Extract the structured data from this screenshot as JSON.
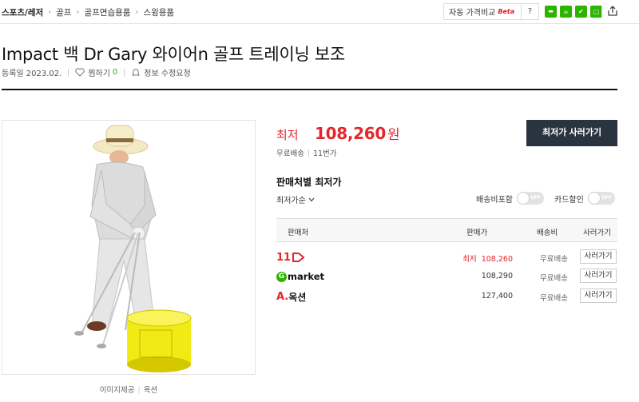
{
  "breadcrumb": {
    "items": [
      "스포츠/레저",
      "골프",
      "골프연습용품",
      "스윙용품"
    ]
  },
  "toolbar": {
    "compare_label": "자동 가격비교",
    "compare_badge": "Beta",
    "help_label": "?"
  },
  "product": {
    "title": "Impact 백 Dr Gary 와이어n 골프 트레이닝 보조",
    "registered": "등록일 2023.02.",
    "wish_label": "찜하기",
    "wish_count": "0",
    "report_label": "정보 수정요청",
    "image_caption_main": "이미지제공",
    "image_caption_source": "옥션"
  },
  "price_panel": {
    "lowest_label": "최저",
    "lowest_price": "108,260",
    "currency": "원",
    "shipping": "무료배송",
    "sellers_count": "11번가",
    "buy_button": "최저가 사러가기",
    "section_title": "판매처별 최저가",
    "sort_label": "최저가순",
    "toggle_shipping_label": "배송비포함",
    "toggle_card_label": "카드할인",
    "toggle_state": "OFF"
  },
  "table": {
    "headers": [
      "판매처",
      "판매가",
      "배송비",
      "사러가기"
    ],
    "rows": [
      {
        "seller": "11번가",
        "lowest_tag": "최저",
        "price": "108,260",
        "shipping": "무료배송",
        "action": "사러가기",
        "highlight": true
      },
      {
        "seller": "Gmarket",
        "lowest_tag": "",
        "price": "108,290",
        "shipping": "무료배송",
        "action": "사러가기",
        "highlight": false
      },
      {
        "seller": "옥션",
        "lowest_tag": "",
        "price": "127,400",
        "shipping": "무료배송",
        "action": "사러가기",
        "highlight": false
      }
    ]
  },
  "colors": {
    "accent_red": "#e5262c",
    "button_dark": "#2a3340",
    "naver_green": "#2db400"
  }
}
